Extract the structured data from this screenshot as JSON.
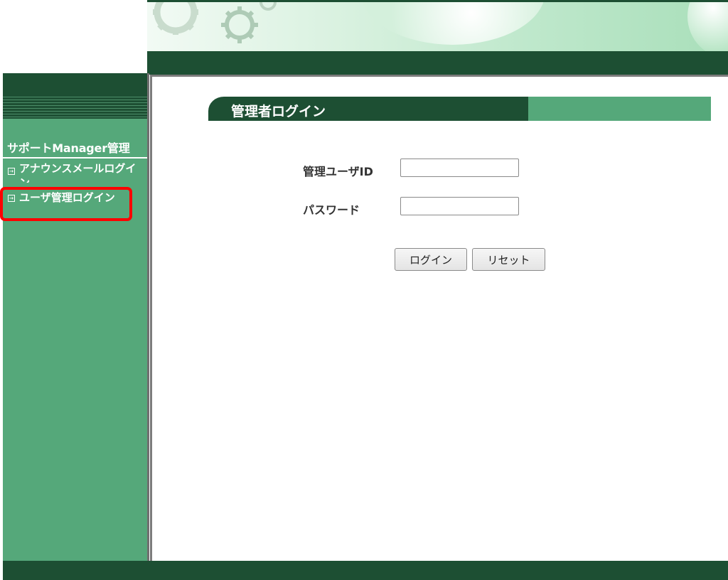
{
  "sidebar": {
    "title": "サポートManager管理",
    "items": [
      {
        "label": "アナウンスメールログイン"
      },
      {
        "label": "ユーザ管理ログイン"
      }
    ]
  },
  "main": {
    "section_title": "管理者ログイン",
    "form": {
      "user_id_label": "管理ユーザID",
      "user_id_value": "",
      "password_label": "パスワード",
      "password_value": ""
    },
    "buttons": {
      "login": "ログイン",
      "reset": "リセット"
    }
  },
  "colors": {
    "dark_green": "#1d4f33",
    "light_green": "#55a87a",
    "highlight_red": "#ff0000"
  },
  "icons": [
    "gear-icon",
    "menu-square-icon"
  ]
}
